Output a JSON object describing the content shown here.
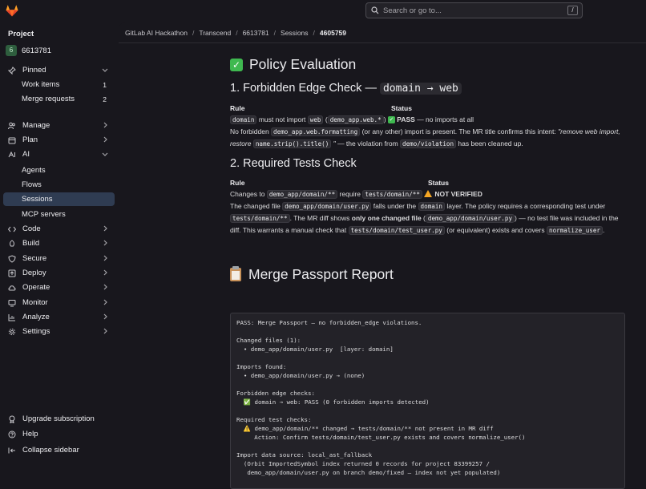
{
  "search": {
    "placeholder": "Search or go to...",
    "shortcut": "/"
  },
  "sidebar": {
    "header": "Project",
    "project": {
      "avatar": "6",
      "name": "6613781"
    },
    "items": [
      {
        "label": "Pinned",
        "icon": "pin-icon"
      },
      {
        "label": "Work items",
        "count": "1"
      },
      {
        "label": "Merge requests",
        "count": "2"
      },
      {
        "label": "Manage",
        "icon": "users-icon"
      },
      {
        "label": "Plan",
        "icon": "calendar-icon"
      },
      {
        "label": "AI",
        "icon": "ai-icon"
      },
      {
        "label": "Agents"
      },
      {
        "label": "Flows"
      },
      {
        "label": "Sessions"
      },
      {
        "label": "MCP servers"
      },
      {
        "label": "Code",
        "icon": "code-icon"
      },
      {
        "label": "Build",
        "icon": "rocket-icon"
      },
      {
        "label": "Secure",
        "icon": "shield-icon"
      },
      {
        "label": "Deploy",
        "icon": "deploy-icon"
      },
      {
        "label": "Operate",
        "icon": "cloud-icon"
      },
      {
        "label": "Monitor",
        "icon": "monitor-icon"
      },
      {
        "label": "Analyze",
        "icon": "chart-icon"
      },
      {
        "label": "Settings",
        "icon": "gear-icon"
      }
    ],
    "bottom": [
      {
        "label": "Upgrade subscription"
      },
      {
        "label": "Help"
      },
      {
        "label": "Collapse sidebar"
      }
    ]
  },
  "breadcrumb": [
    "GitLab AI Hackathon",
    "Transcend",
    "6613781",
    "Sessions",
    "4605759"
  ],
  "content": {
    "title": "Policy Evaluation",
    "check1": {
      "heading": "1. Forbidden Edge Check —",
      "heading_code": "domain → web",
      "col_rule": "Rule",
      "col_status": "Status",
      "rule_code1": "domain",
      "rule_text1": "must not import",
      "rule_code2": "web",
      "rule_code3": "demo_app.web.*",
      "status_pass": "PASS",
      "status_tail": "— no imports at all",
      "p1": "No forbidden",
      "p1_code": "demo_app.web.formatting",
      "p1_b": "(or any other) import is present. The MR title confirms this intent: ",
      "p1_italic": "\"remove web import, restore",
      "p1_code2": "name.strip().title()",
      "p1_italic2": "\"",
      "p1_c": "— the violation from",
      "p1_code3": "demo/violation",
      "p1_d": "has been cleaned up."
    },
    "check2": {
      "heading": "2. Required Tests Check",
      "col_rule": "Rule",
      "col_status": "Status",
      "rule_a": "Changes to",
      "rule_code1": "demo_app/domain/**",
      "rule_b": "require",
      "rule_code2": "tests/domain/**",
      "status": "NOT VERIFIED",
      "p_a": "The changed file",
      "p_code1": "demo_app/domain/user.py",
      "p_b": "falls under the",
      "p_code2": "domain",
      "p_c": "layer. The policy requires a corresponding test",
      "p_d": "under",
      "p_code3": "tests/domain/**",
      "p_e": ". The MR diff shows",
      "p_bold": "only one changed file",
      "p_code4": "demo_app/domain/user.py",
      "p_f": "— no test file was",
      "p_g": "included in the diff. This warrants a manual check that",
      "p_code5": "tests/domain/test_user.py",
      "p_h": "(or equivalent) exists and covers",
      "p_code6": "normalize_user",
      "p_i": "."
    },
    "report_title": "Merge Passport Report",
    "report_lines": [
      "PASS: Merge Passport — no forbidden_edge violations.",
      "",
      "Changed files (1):",
      "  • demo_app/domain/user.py  [layer: domain]",
      "",
      "Imports found:",
      "  • demo_app/domain/user.py → (none)",
      "",
      "Forbidden edge checks:",
      "  ✅ domain → web: PASS (0 forbidden imports detected)",
      "",
      "Required test checks:",
      "  ⚠️ demo_app/domain/** changed → tests/domain/** not present in MR diff",
      "     Action: Confirm tests/domain/test_user.py exists and covers normalize_user()",
      "",
      "Import data source: local_ast_fallback",
      "  (Orbit ImportedSymbol index returned 0 records for project 83399257 /",
      "   demo_app/domain/user.py on branch demo/fixed — index not yet populated)"
    ]
  }
}
